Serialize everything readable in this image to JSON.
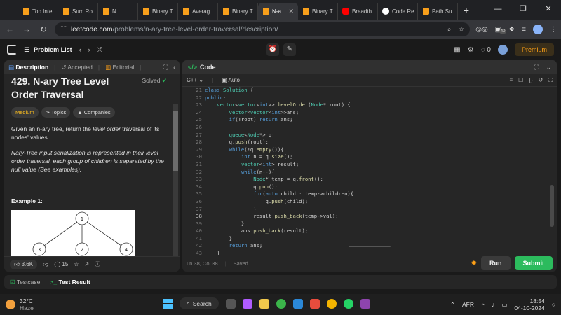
{
  "browser": {
    "tabs": [
      {
        "label": "Top Inte",
        "icon": "leetcode-icon",
        "active": false
      },
      {
        "label": "Sum Ro",
        "icon": "leetcode-icon",
        "active": false
      },
      {
        "label": "N",
        "icon": "leetcode-icon",
        "active": false
      },
      {
        "label": "Binary T",
        "icon": "leetcode-icon",
        "active": false
      },
      {
        "label": "Averag",
        "icon": "leetcode-icon",
        "active": false
      },
      {
        "label": "Binary T",
        "icon": "leetcode-icon",
        "active": false
      },
      {
        "label": "N-a",
        "icon": "leetcode-icon",
        "active": true
      },
      {
        "label": "Binary T",
        "icon": "leetcode-icon",
        "active": false
      },
      {
        "label": "Breadth",
        "icon": "youtube-icon",
        "active": false
      },
      {
        "label": "Code Re",
        "icon": "github-icon",
        "active": false
      },
      {
        "label": "Path Su",
        "icon": "leetcode-icon",
        "active": false
      }
    ],
    "new_tab": "+",
    "url_host": "leetcode.com",
    "url_path": "/problems/n-ary-tree-level-order-traversal/description/",
    "ext_badge": "40"
  },
  "header": {
    "problem_list": "Problem List",
    "premium": "Premium",
    "coins": "0"
  },
  "left": {
    "tabs": {
      "description": "Description",
      "accepted": "Accepted",
      "editorial": "Editorial"
    },
    "title": "429. N-ary Tree Level Order Traversal",
    "solved": "Solved",
    "chips": {
      "difficulty": "Medium",
      "topics": "Topics",
      "companies": "Companies"
    },
    "desc_pre": "Given an n-ary tree, return the ",
    "desc_em": "level order",
    "desc_post": " traversal of its nodes' values.",
    "desc2": "Nary-Tree input serialization is represented in their level order traversal, each group of children is separated by the null value (See examples).",
    "example_title": "Example 1:",
    "tree_nodes": [
      "1",
      "3",
      "2",
      "4"
    ],
    "footer": {
      "likes": "3.6K",
      "comments": "15"
    }
  },
  "right": {
    "title": "Code",
    "language": "C++",
    "mode": "Auto",
    "status": "Ln 38, Col 38",
    "saved": "Saved",
    "run": "Run",
    "submit": "Submit",
    "code_lines": [
      {
        "n": "21",
        "text": "class Solution {"
      },
      {
        "n": "22",
        "text": "public:"
      },
      {
        "n": "23",
        "text": "    vector<vector<int>> levelOrder(Node* root) {"
      },
      {
        "n": "24",
        "text": "        vector<vector<int>>ans;"
      },
      {
        "n": "25",
        "text": "        if(!root) return ans;"
      },
      {
        "n": "26",
        "text": ""
      },
      {
        "n": "27",
        "text": "        queue<Node*> q;"
      },
      {
        "n": "28",
        "text": "        q.push(root);"
      },
      {
        "n": "29",
        "text": "        while(!q.empty()){"
      },
      {
        "n": "30",
        "text": "            int n = q.size();"
      },
      {
        "n": "31",
        "text": "            vector<int> result;"
      },
      {
        "n": "32",
        "text": "            while(n--){"
      },
      {
        "n": "33",
        "text": "                Node* temp = q.front();"
      },
      {
        "n": "34",
        "text": "                q.pop();"
      },
      {
        "n": "35",
        "text": "                for(auto child : temp->children){"
      },
      {
        "n": "36",
        "text": "                    q.push(child);"
      },
      {
        "n": "37",
        "text": "                }"
      },
      {
        "n": "38",
        "text": "                result.push_back(temp->val);"
      },
      {
        "n": "39",
        "text": "            }"
      },
      {
        "n": "40",
        "text": "            ans.push_back(result);"
      },
      {
        "n": "41",
        "text": "        }"
      },
      {
        "n": "42",
        "text": "        return ans;"
      },
      {
        "n": "43",
        "text": "    }"
      }
    ]
  },
  "bottom": {
    "testcase": "Testcase",
    "test_result": "Test Result"
  },
  "taskbar": {
    "temp": "32°C",
    "weather": "Haze",
    "search": "Search",
    "lang": "AFR",
    "time": "18:54",
    "date": "04-10-2024"
  }
}
